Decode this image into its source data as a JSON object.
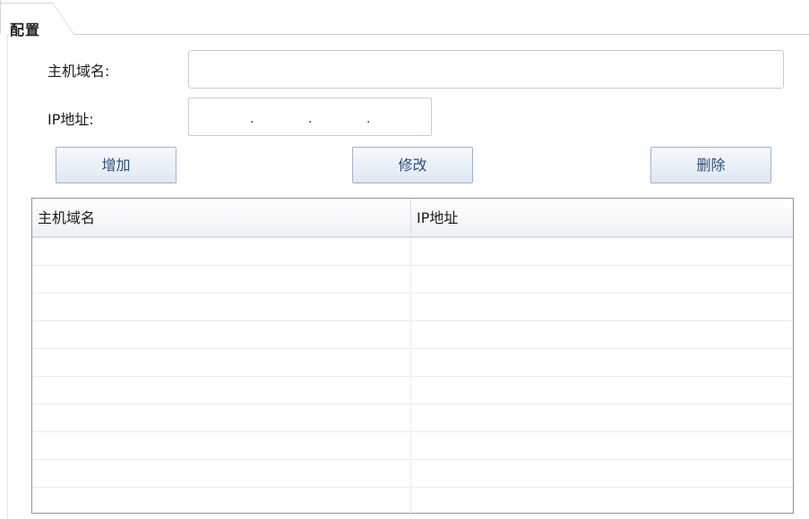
{
  "tab": {
    "label": "配置"
  },
  "form": {
    "hostname_label": "主机域名:",
    "hostname_value": "",
    "ip_label": "IP地址:",
    "ip_segments": [
      "",
      "",
      "",
      ""
    ],
    "ip_separator": "."
  },
  "buttons": {
    "add_label": "增加",
    "edit_label": "修改",
    "delete_label": "删除"
  },
  "table": {
    "columns": [
      "主机域名",
      "IP地址"
    ],
    "rows": [
      [
        "",
        ""
      ],
      [
        "",
        ""
      ],
      [
        "",
        ""
      ],
      [
        "",
        ""
      ],
      [
        "",
        ""
      ],
      [
        "",
        ""
      ],
      [
        "",
        ""
      ],
      [
        "",
        ""
      ],
      [
        "",
        ""
      ],
      [
        "",
        ""
      ]
    ]
  },
  "colors": {
    "button_text": "#2c4e7d",
    "button_border": "#9fb3cc",
    "table_border": "#8e949c"
  }
}
